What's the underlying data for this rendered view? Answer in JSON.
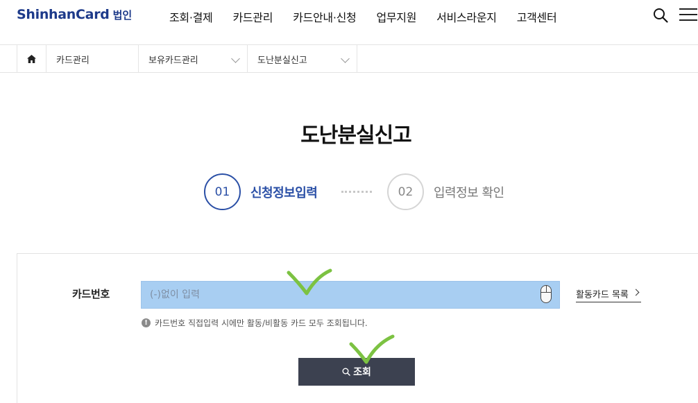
{
  "header": {
    "brand": "ShinhanCard",
    "brand_sub": "법인",
    "nav": [
      "조회·결제",
      "카드관리",
      "카드안내·신청",
      "업무지원",
      "서비스라운지",
      "고객센터"
    ]
  },
  "breadcrumb": {
    "level1": "카드관리",
    "level2": "보유카드관리",
    "level3": "도난분실신고"
  },
  "page": {
    "title": "도난분실신고"
  },
  "steps": [
    {
      "number": "01",
      "label": "신청정보입력",
      "active": true
    },
    {
      "number": "02",
      "label": "입력정보 확인",
      "active": false
    }
  ],
  "form": {
    "card_label": "카드번호",
    "card_placeholder": "(-)없이 입력",
    "card_value": "",
    "card_list_link": "활동카드 목록",
    "notice": "카드번호 직접입력 시에만 활동/비활동 카드 모두 조회됩니다.",
    "search_button": "조회"
  },
  "colors": {
    "brand": "#1d3a8a",
    "step_active": "#2a4fa6",
    "input_highlight": "#a8cef2",
    "button_bg": "#3c4150",
    "annotation_check": "#7cc242"
  }
}
